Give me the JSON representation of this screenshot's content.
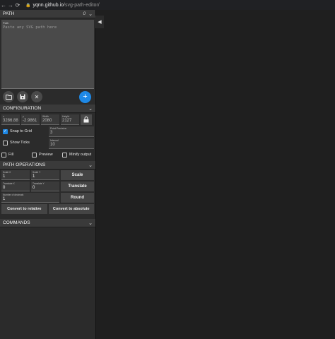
{
  "browser": {
    "back_icon": "←",
    "forward_icon": "→",
    "reload_icon": "⟳",
    "lock_icon": "🔒",
    "host": "yqnn.github.io",
    "path": "/svg-path-editor/"
  },
  "collapse_icon": "◀",
  "path_section": {
    "title": "PATH",
    "count": "0",
    "field_label": "Path",
    "placeholder": "Paste any SVG path here"
  },
  "actions": {
    "open_icon": "📁",
    "save_icon": "💾",
    "clear_icon": "✕",
    "add_icon": "+"
  },
  "configuration": {
    "title": "CONFIGURATION",
    "fields": [
      {
        "label": "x",
        "value": "3286.88"
      },
      {
        "label": "y",
        "value": "-2.9861"
      },
      {
        "label": "Width",
        "value": "2080"
      },
      {
        "label": "Height",
        "value": "2127"
      }
    ],
    "lock_icon": "🔒",
    "snap_to_grid": "Snap to Grid",
    "point_precision_label": "Point Precision",
    "point_precision_value": "3",
    "show_ticks": "Show Ticks",
    "interval_label": "Interval",
    "interval_value": "10",
    "fill": "Fill",
    "preview": "Preview",
    "minify_output": "Minify output"
  },
  "path_operations": {
    "title": "PATH OPERATIONS",
    "scale_x_label": "Scale X",
    "scale_x_value": "1",
    "scale_y_label": "Scale Y",
    "scale_y_value": "1",
    "scale_button": "Scale",
    "translate_x_label": "Translate X",
    "translate_x_value": "0",
    "translate_y_label": "Translate Y",
    "translate_y_value": "0",
    "translate_button": "Translate",
    "decimals_label": "Number of decimals",
    "decimals_value": "1",
    "round_button": "Round",
    "convert_relative": "Convert to relative",
    "convert_absolute": "Convert to absolute"
  },
  "commands": {
    "title": "COMMANDS"
  }
}
